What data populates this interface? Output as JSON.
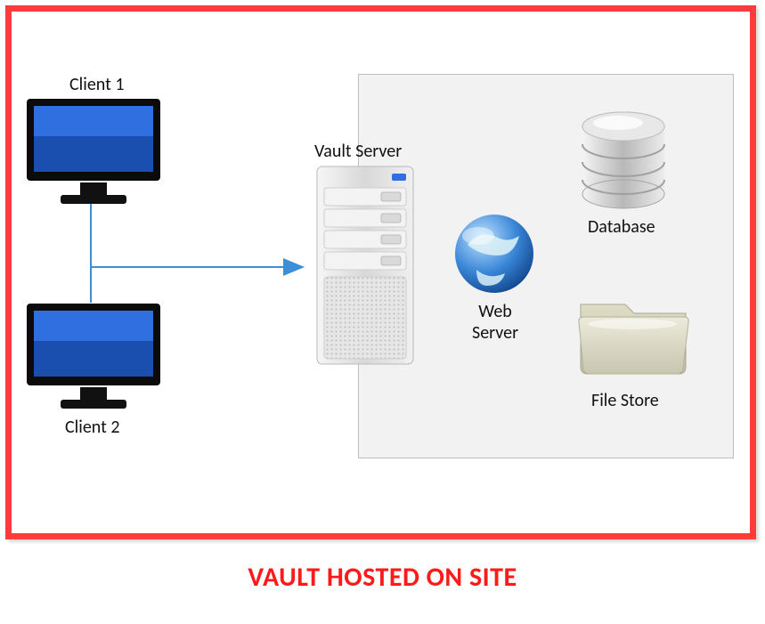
{
  "diagram": {
    "title_caption": "VAULT HOSTED ON SITE",
    "nodes": {
      "client1_label": "Client 1",
      "client2_label": "Client 2",
      "vault_server_label": "Vault Server",
      "web_server_label_line1": "Web",
      "web_server_label_line2": "Server",
      "database_label": "Database",
      "file_store_label": "File Store"
    }
  }
}
